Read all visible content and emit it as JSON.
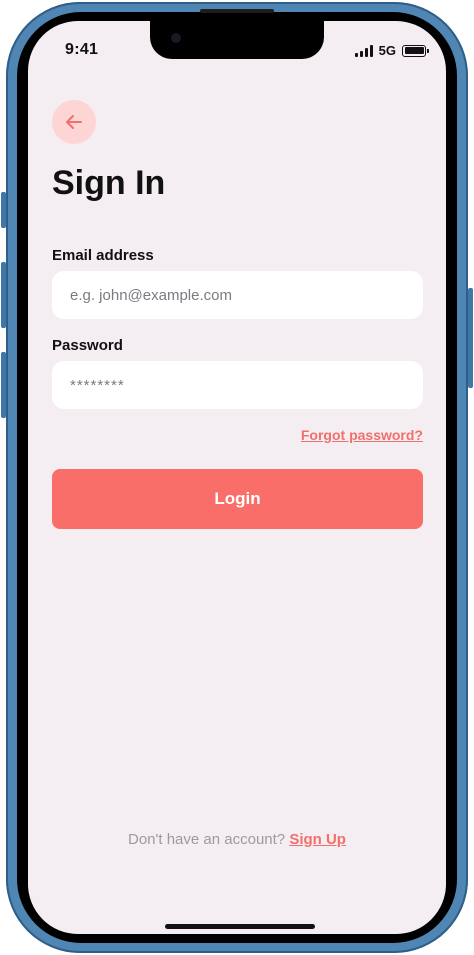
{
  "status_bar": {
    "time": "9:41",
    "network": "5G",
    "icons": [
      "signal-icon",
      "battery-icon"
    ]
  },
  "header": {
    "back_icon": "arrow-left-icon",
    "title": "Sign In"
  },
  "form": {
    "email": {
      "label": "Email address",
      "placeholder": "e.g. john@example.com",
      "value": ""
    },
    "password": {
      "label": "Password",
      "placeholder": "********",
      "value": ""
    },
    "forgot_label": "Forgot password?",
    "login_label": "Login"
  },
  "footer": {
    "prompt": "Don't have an account?",
    "signup_label": "Sign Up"
  },
  "colors": {
    "accent": "#fa6e6a",
    "link": "#f26f6b",
    "back_bg": "#fdd5d5",
    "screen_bg": "#f4eef2",
    "frame": "#4f86b4"
  }
}
